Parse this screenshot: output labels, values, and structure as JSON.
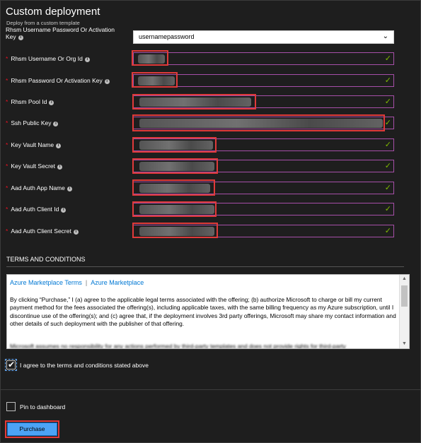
{
  "header": {
    "title": "Custom deployment",
    "subtitle": "Deploy from a custom template"
  },
  "key_row": {
    "label_line1": "Rhsm Username Password Or Activation",
    "label_line2": "Key",
    "selected_value": "usernamepassword"
  },
  "fields": [
    {
      "label": "Rhsm Username Or Org Id"
    },
    {
      "label": "Rhsm Password Or Activation Key"
    },
    {
      "label": "Rhsm Pool Id"
    },
    {
      "label": "Ssh Public Key"
    },
    {
      "label": "Key Vault Name"
    },
    {
      "label": "Key Vault Secret"
    },
    {
      "label": "Aad Auth App Name"
    },
    {
      "label": "Aad Auth Client Id"
    },
    {
      "label": "Aad Auth Client Secret"
    }
  ],
  "terms": {
    "section_title": "TERMS AND CONDITIONS",
    "link1": "Azure Marketplace Terms",
    "separator": "|",
    "link2": "Azure Marketplace",
    "paragraph": "By clicking “Purchase,” I (a) agree to the applicable legal terms associated with the offering; (b) authorize Microsoft to charge or bill my current payment method for the fees associated the offering(s), including applicable taxes, with the same billing frequency as my Azure subscription, until I discontinue use of the offering(s); and (c) agree that, if the deployment involves 3rd party offerings, Microsoft may share my contact information and other details of such deployment with the publisher of that offering.",
    "paragraph2": "Microsoft assumes no responsibility for any actions performed by third-party templates and does not provide rights for third-party",
    "agree_label": "I agree to the terms and conditions stated above",
    "agree_checked": true
  },
  "footer": {
    "pin_label": "Pin to dashboard",
    "pin_checked": false,
    "purchase_label": "Purchase"
  },
  "colors": {
    "accent_border": "#a64fa8",
    "valid_check": "#7fba00",
    "highlight": "#e03a3a",
    "primary_button": "#4ca3f5"
  }
}
